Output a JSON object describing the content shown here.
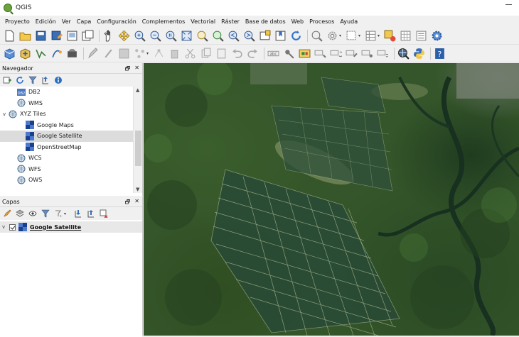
{
  "window": {
    "title": "QGIS"
  },
  "menu": [
    "Proyecto",
    "Edición",
    "Ver",
    "Capa",
    "Configuración",
    "Complementos",
    "Vectorial",
    "Ráster",
    "Base de datos",
    "Web",
    "Procesos",
    "Ayuda"
  ],
  "navigator": {
    "title": "Navegador",
    "controls": [
      "🗗",
      "✕"
    ],
    "items": [
      {
        "label": "DB2",
        "icon": "db2-icon",
        "indent": 1,
        "expander": ""
      },
      {
        "label": "WMS",
        "icon": "globe-icon",
        "indent": 1,
        "expander": ""
      },
      {
        "label": "XYZ Tiles",
        "icon": "globe-icon",
        "indent": 0,
        "expander": "v"
      },
      {
        "label": "Google Maps",
        "icon": "tile-icon",
        "indent": 2,
        "expander": ""
      },
      {
        "label": "Google Satellite",
        "icon": "tile-icon",
        "indent": 2,
        "expander": "",
        "selected": true
      },
      {
        "label": "OpenStreetMap",
        "icon": "tile-icon",
        "indent": 2,
        "expander": ""
      },
      {
        "label": "WCS",
        "icon": "globe-icon",
        "indent": 1,
        "expander": ""
      },
      {
        "label": "WFS",
        "icon": "globe-icon",
        "indent": 1,
        "expander": ""
      },
      {
        "label": "OWS",
        "icon": "globe-icon",
        "indent": 1,
        "expander": ""
      }
    ]
  },
  "layers": {
    "title": "Capas",
    "controls": [
      "🗗",
      "✕"
    ],
    "items": [
      {
        "label": "Google Satellite",
        "checked": true
      }
    ]
  },
  "colors": {
    "accent_blue": "#1f5fbf",
    "tile_blue": "#1c3f8c",
    "map_green": "#35562a"
  }
}
